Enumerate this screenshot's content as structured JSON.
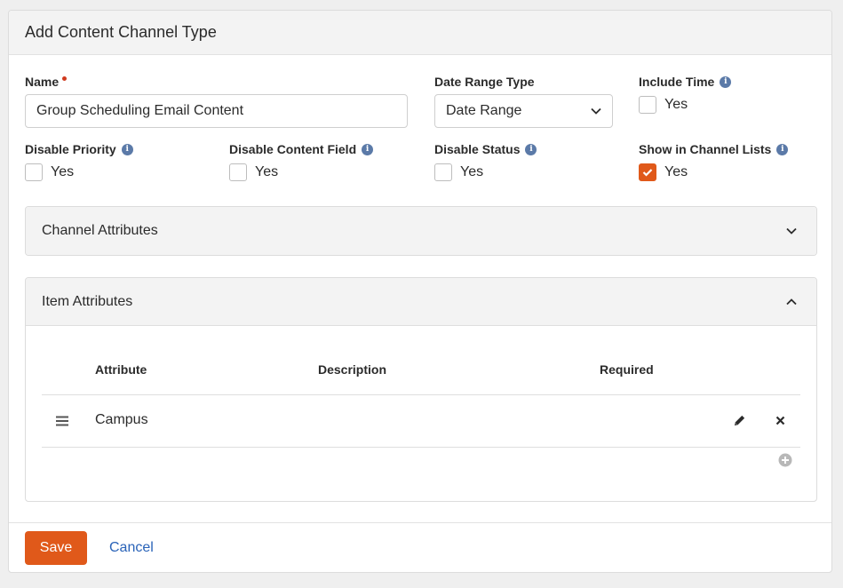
{
  "header": {
    "title": "Add Content Channel Type"
  },
  "fields": {
    "name": {
      "label": "Name",
      "value": "Group Scheduling Email Content"
    },
    "date_range_type": {
      "label": "Date Range Type",
      "value": "Date Range"
    },
    "include_time": {
      "label": "Include Time",
      "option": "Yes",
      "checked": false
    },
    "disable_priority": {
      "label": "Disable Priority",
      "option": "Yes",
      "checked": false
    },
    "disable_content_field": {
      "label": "Disable Content Field",
      "option": "Yes",
      "checked": false
    },
    "disable_status": {
      "label": "Disable Status",
      "option": "Yes",
      "checked": false
    },
    "show_in_channel_lists": {
      "label": "Show in Channel Lists",
      "option": "Yes",
      "checked": true
    }
  },
  "channel_attributes": {
    "title": "Channel Attributes"
  },
  "item_attributes": {
    "title": "Item Attributes",
    "columns": [
      "Attribute",
      "Description",
      "Required"
    ],
    "rows": [
      {
        "attribute": "Campus",
        "description": "",
        "required": ""
      }
    ]
  },
  "actions": {
    "save_label": "Save",
    "cancel_label": "Cancel"
  },
  "colors": {
    "accent": "#e0591a",
    "link": "#2a63b8",
    "info": "#5b7aa8"
  }
}
